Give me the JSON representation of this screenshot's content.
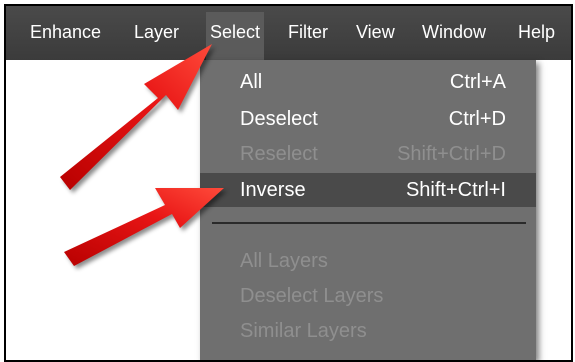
{
  "menubar": {
    "items": [
      {
        "label": "Enhance"
      },
      {
        "label": "Layer"
      },
      {
        "label": "Select"
      },
      {
        "label": "Filter"
      },
      {
        "label": "View"
      },
      {
        "label": "Window"
      },
      {
        "label": "Help"
      }
    ]
  },
  "select_menu": {
    "items": [
      {
        "label": "All",
        "shortcut": "Ctrl+A",
        "enabled": true
      },
      {
        "label": "Deselect",
        "shortcut": "Ctrl+D",
        "enabled": true
      },
      {
        "label": "Reselect",
        "shortcut": "Shift+Ctrl+D",
        "enabled": false
      },
      {
        "label": "Inverse",
        "shortcut": "Shift+Ctrl+I",
        "enabled": true,
        "highlighted": true
      },
      {
        "label": "All Layers",
        "shortcut": "",
        "enabled": false
      },
      {
        "label": "Deselect Layers",
        "shortcut": "",
        "enabled": false
      },
      {
        "label": "Similar Layers",
        "shortcut": "",
        "enabled": false
      }
    ]
  },
  "colors": {
    "menubar": "#3b3b3b",
    "dropdown": "#6f6f6f",
    "highlight": "#4a4a4a",
    "arrow": "#e01010"
  }
}
